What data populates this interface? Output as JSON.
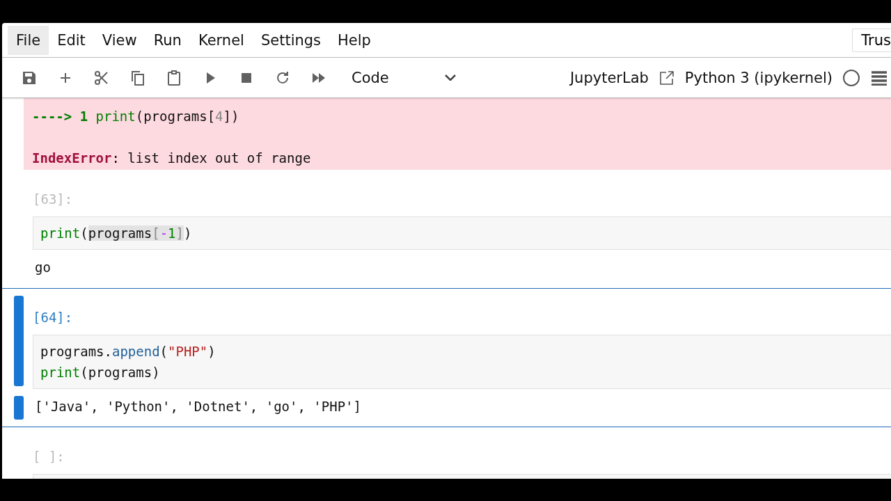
{
  "menu": [
    {
      "label": "File",
      "selected": true
    },
    {
      "label": "Edit",
      "selected": false
    },
    {
      "label": "View",
      "selected": false
    },
    {
      "label": "Run",
      "selected": false
    },
    {
      "label": "Kernel",
      "selected": false
    },
    {
      "label": "Settings",
      "selected": false
    },
    {
      "label": "Help",
      "selected": false
    }
  ],
  "trusted": "Trus",
  "toolbar": {
    "cell_type": "Code",
    "link": "JupyterLab",
    "kernel": "Python 3 (ipykernel)",
    "kernel_busy": false
  },
  "cells": [
    {
      "kind": "error",
      "lines": [
        {
          "kind": "text",
          "tokens": [
            {
              "kind": "arrow",
              "text": "----> 1 "
            },
            {
              "kind": "fn",
              "text": "print"
            },
            {
              "kind": "plain",
              "text": "(programs["
            },
            {
              "kind": "dim",
              "text": "4"
            },
            {
              "kind": "plain",
              "text": "])"
            }
          ]
        },
        {
          "kind": "blank"
        },
        {
          "kind": "text",
          "tokens": [
            {
              "kind": "err",
              "text": "IndexError"
            },
            {
              "kind": "plain",
              "text": ": list index out of range"
            }
          ]
        }
      ]
    },
    {
      "kind": "code",
      "prompt": "[63]:",
      "selected": false,
      "input": [
        [
          {
            "kind": "fn",
            "text": "print"
          },
          {
            "kind": "plain",
            "text": "("
          },
          {
            "kind": "plain",
            "text": "programs",
            "highlight": true
          },
          {
            "kind": "dim",
            "text": "[",
            "highlight": true
          },
          {
            "kind": "op",
            "text": "-",
            "highlight": true
          },
          {
            "kind": "num",
            "text": "1",
            "highlight": true
          },
          {
            "kind": "dim",
            "text": "]",
            "highlight": true
          },
          {
            "kind": "plain",
            "text": ")"
          }
        ]
      ],
      "output": "go"
    },
    {
      "kind": "code",
      "prompt": "[64]:",
      "selected": true,
      "input": [
        [
          {
            "kind": "plain",
            "text": "programs."
          },
          {
            "kind": "attr",
            "text": "append"
          },
          {
            "kind": "plain",
            "text": "("
          },
          {
            "kind": "str",
            "text": "\"PHP\""
          },
          {
            "kind": "plain",
            "text": ")"
          }
        ],
        [
          {
            "kind": "fn",
            "text": "print"
          },
          {
            "kind": "plain",
            "text": "(programs)"
          }
        ]
      ],
      "output": "['Java', 'Python', 'Dotnet', 'go', 'PHP']"
    },
    {
      "kind": "code",
      "prompt": "[ ]:",
      "selected": false
    }
  ]
}
